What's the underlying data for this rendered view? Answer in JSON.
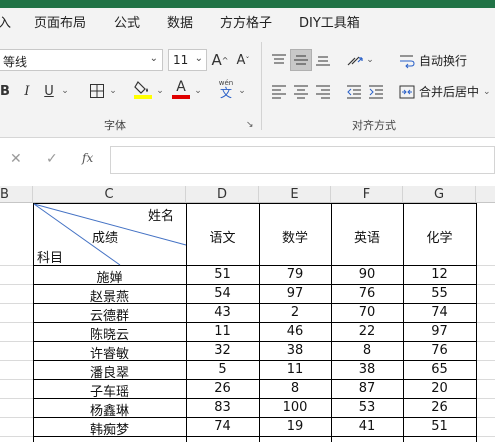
{
  "menu": {
    "items": [
      "入",
      "页面布局",
      "公式",
      "数据",
      "方方格子",
      "DIY工具箱"
    ]
  },
  "ribbon": {
    "font_name": "等线",
    "font_size": "11",
    "font_group_label": "字体",
    "align_group_label": "对齐方式",
    "wrap_text_label": "自动换行",
    "merge_center_label": "合并后居中",
    "bold": "B",
    "italic": "I",
    "underline": "U",
    "grow_font": "A",
    "shrink_font": "A",
    "phonetic": "文",
    "phonetic_top": "wén",
    "font_color_letter": "A",
    "fill_color": "#ffff00",
    "font_color": "#e00000"
  },
  "formula_bar": {
    "cancel": "✕",
    "enter": "✓",
    "fx": "fx",
    "value": ""
  },
  "columns": [
    "B",
    "C",
    "D",
    "E",
    "F",
    "G"
  ],
  "header_cell": {
    "top_right": "姓名",
    "middle": "成绩",
    "bottom_left": "科目"
  },
  "subjects": [
    "语文",
    "数学",
    "英语",
    "化学"
  ],
  "rows": [
    {
      "name": "施婵",
      "scores": [
        "51",
        "79",
        "90",
        "12"
      ]
    },
    {
      "name": "赵景燕",
      "scores": [
        "54",
        "97",
        "76",
        "55"
      ]
    },
    {
      "name": "云德群",
      "scores": [
        "43",
        "2",
        "70",
        "74"
      ]
    },
    {
      "name": "陈晓云",
      "scores": [
        "11",
        "46",
        "22",
        "97"
      ]
    },
    {
      "name": "许睿敏",
      "scores": [
        "32",
        "38",
        "8",
        "76"
      ]
    },
    {
      "name": "潘良翠",
      "scores": [
        "5",
        "11",
        "38",
        "65"
      ]
    },
    {
      "name": "子车瑶",
      "scores": [
        "26",
        "8",
        "87",
        "20"
      ]
    },
    {
      "name": "杨鑫琳",
      "scores": [
        "83",
        "100",
        "53",
        "26"
      ]
    },
    {
      "name": "韩痴梦",
      "scores": [
        "74",
        "19",
        "41",
        "51"
      ]
    }
  ]
}
